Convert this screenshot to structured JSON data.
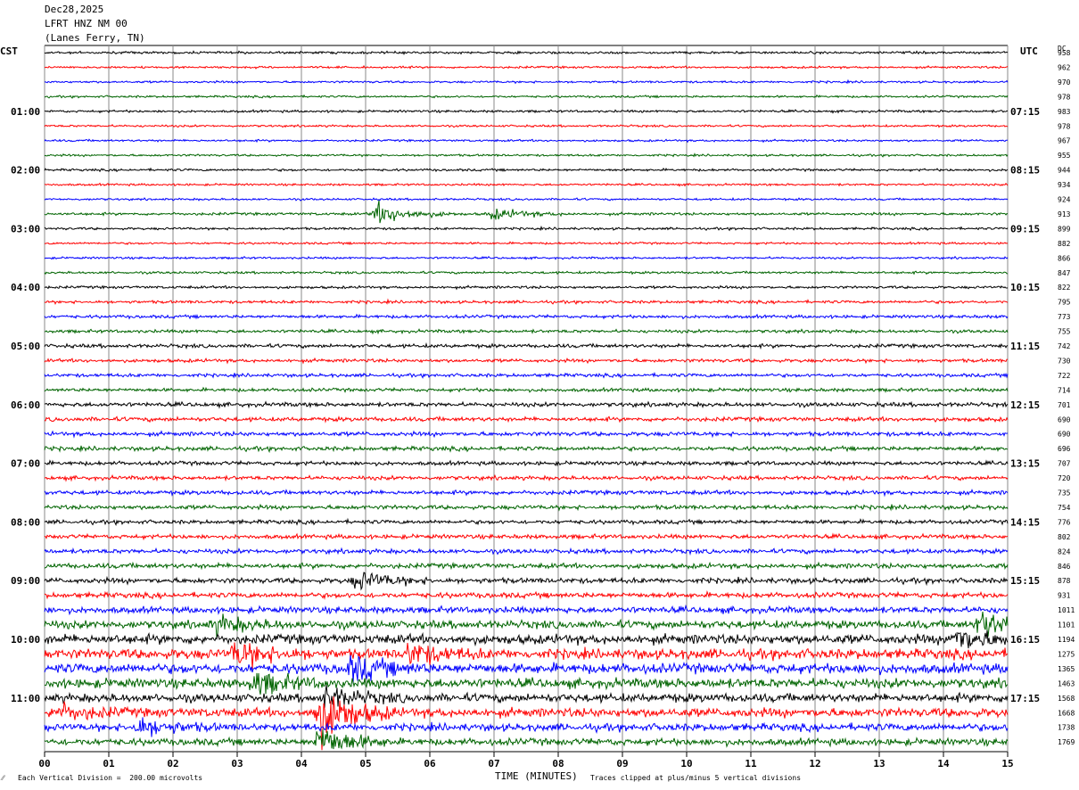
{
  "header": {
    "date": "Dec28,2025",
    "station": "LFRT HNZ NM 00",
    "location": "(Lanes Ferry, TN)"
  },
  "left_tz": "CST",
  "right_tz": "UTC",
  "dc_label": "DC",
  "footer": {
    "scale_note": "Each Vertical Division =  200.00 microvolts",
    "xaxis_title": "TIME (MINUTES)",
    "clip_note": "Traces clipped at plus/minus 5 vertical divisions",
    "corner_mark": "⁄⁄"
  },
  "colors": {
    "black": "#000000",
    "red": "#ff0000",
    "blue": "#0000ff",
    "green": "#006400",
    "grid": "#888888"
  },
  "chart_data": {
    "type": "line",
    "description_rows": 48,
    "trace_color_cycle": [
      "black",
      "red",
      "blue",
      "green"
    ],
    "x_ticks": [
      "00",
      "01",
      "02",
      "03",
      "04",
      "05",
      "06",
      "07",
      "08",
      "09",
      "10",
      "11",
      "12",
      "13",
      "14",
      "15"
    ],
    "xlim": [
      0,
      15
    ],
    "left_hour_labels": [
      "01:00",
      "02:00",
      "03:00",
      "04:00",
      "05:00",
      "06:00",
      "07:00",
      "08:00",
      "09:00",
      "10:00",
      "11:00"
    ],
    "right_hour_labels": [
      "07:15",
      "08:15",
      "09:15",
      "10:15",
      "11:15",
      "12:15",
      "13:15",
      "14:15",
      "15:15",
      "16:15",
      "17:15"
    ],
    "dc_offsets": [
      958,
      962,
      970,
      978,
      983,
      978,
      967,
      955,
      944,
      934,
      924,
      913,
      899,
      882,
      866,
      847,
      822,
      795,
      773,
      755,
      742,
      730,
      722,
      714,
      701,
      690,
      690,
      696,
      707,
      720,
      735,
      754,
      776,
      802,
      824,
      846,
      878,
      931,
      1011,
      1101,
      1194,
      1275,
      1365,
      1463,
      1568,
      1668,
      1738,
      1769
    ],
    "trace_amplitudes": [
      0.9,
      0.8,
      0.8,
      0.8,
      0.9,
      0.8,
      0.8,
      0.8,
      0.9,
      0.8,
      0.8,
      1.0,
      0.9,
      0.8,
      0.8,
      0.9,
      1.0,
      1.1,
      1.2,
      1.2,
      1.4,
      1.3,
      1.3,
      1.3,
      1.6,
      1.6,
      1.6,
      1.6,
      1.5,
      1.5,
      1.6,
      1.6,
      1.5,
      1.6,
      1.7,
      1.9,
      2.0,
      2.0,
      2.4,
      3.0,
      3.6,
      3.8,
      3.8,
      3.6,
      3.2,
      3.4,
      2.8,
      2.6
    ],
    "events": [
      {
        "row": 11,
        "minute": 5.2,
        "amp": 8
      },
      {
        "row": 11,
        "minute": 7.0,
        "amp": 4
      },
      {
        "row": 36,
        "minute": 4.9,
        "amp": 7
      },
      {
        "row": 39,
        "minute": 2.7,
        "amp": 6
      },
      {
        "row": 39,
        "minute": 14.6,
        "amp": 10
      },
      {
        "row": 40,
        "minute": 14.2,
        "amp": 9
      },
      {
        "row": 41,
        "minute": 3.0,
        "amp": 9
      },
      {
        "row": 41,
        "minute": 5.7,
        "amp": 8
      },
      {
        "row": 42,
        "minute": 4.8,
        "amp": 9
      },
      {
        "row": 43,
        "minute": 3.3,
        "amp": 8
      },
      {
        "row": 44,
        "minute": 4.4,
        "amp": 8
      },
      {
        "row": 45,
        "minute": 4.3,
        "amp": 22
      },
      {
        "row": 45,
        "minute": 0.2,
        "amp": 6
      },
      {
        "row": 46,
        "minute": 1.5,
        "amp": 7
      },
      {
        "row": 47,
        "minute": 4.3,
        "amp": 12
      }
    ]
  }
}
